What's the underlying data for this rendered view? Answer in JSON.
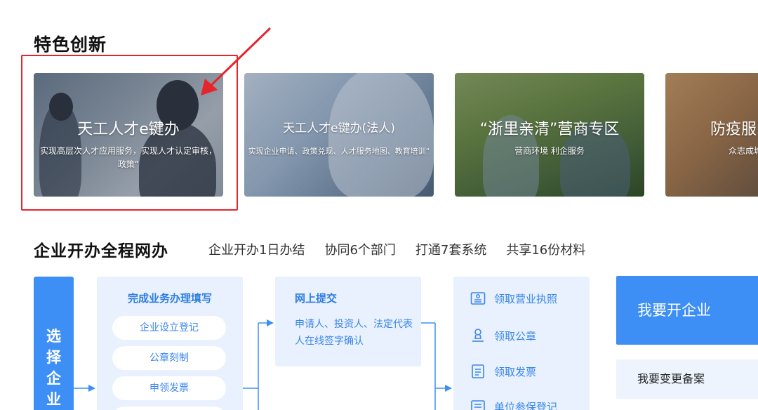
{
  "featured": {
    "title": "特色创新",
    "cards": [
      {
        "title": "天工人才e键办",
        "desc": "实现高层次人才应用服务，实现人才认定审核，政策“"
      },
      {
        "title": "天工人才e键办(法人)",
        "desc": "实现企业申请、政策兑现、人才服务地图、教育培训“"
      },
      {
        "title": "“浙里亲清”营商专区",
        "desc": "营商环境 利企服务"
      },
      {
        "title": "防疫服",
        "desc": "众志成城"
      }
    ]
  },
  "business": {
    "title": "企业开办全程网办",
    "tags": [
      "企业开办1日办结",
      "协同6个部门",
      "打通7套系统",
      "共享16份材料"
    ],
    "side_label": [
      "选",
      "择",
      "企",
      "业"
    ],
    "step1": {
      "title": "完成业务办理填写",
      "items": [
        "企业设立登记",
        "公章刻制",
        "申领发票"
      ]
    },
    "step2": {
      "title": "网上提交",
      "text": "申请人、投资人、法定代表人在线签字确认"
    },
    "step3": {
      "items": [
        {
          "label": "领取营业执照",
          "icon": "license-icon"
        },
        {
          "label": "领取公章",
          "icon": "stamp-icon"
        },
        {
          "label": "领取发票",
          "icon": "invoice-icon"
        },
        {
          "label": "单位参保登记",
          "icon": "insurance-icon"
        }
      ]
    },
    "actions": {
      "open_label": "我要开企业",
      "change_label": "我要变更备案"
    }
  },
  "colors": {
    "accent": "#3d8ff5",
    "panel": "#e8f1fd",
    "highlight": "#e5242b"
  }
}
